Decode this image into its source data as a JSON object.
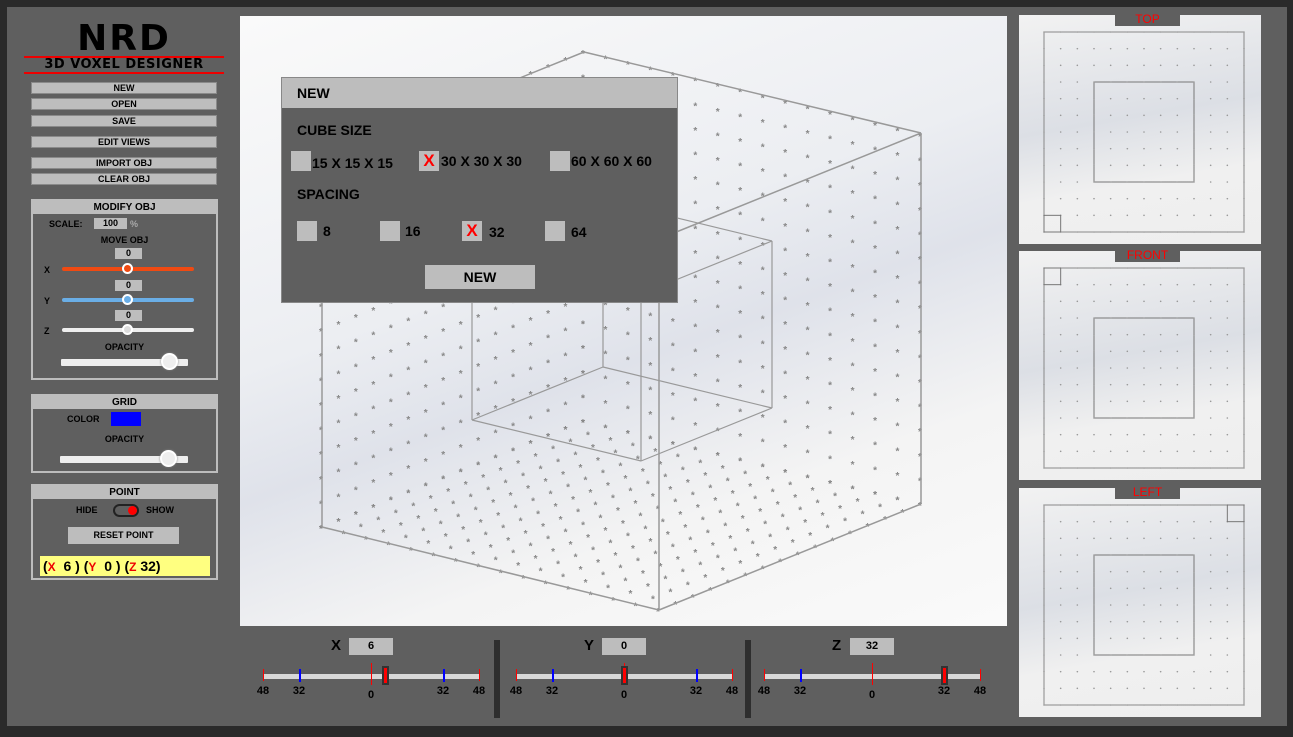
{
  "logo": {
    "title": "NRD",
    "subtitle": "3D VOXEL DESIGNER"
  },
  "menu": {
    "new": "NEW",
    "open": "OPEN",
    "save": "SAVE",
    "edit_views": "EDIT VIEWS",
    "import_obj": "IMPORT OBJ",
    "clear_obj": "CLEAR OBJ"
  },
  "modify": {
    "title": "MODIFY OBJ",
    "scale_label": "SCALE:",
    "scale_value": "100",
    "scale_unit": "%",
    "move_label": "MOVE OBJ",
    "x_label": "X",
    "y_label": "Y",
    "z_label": "Z",
    "x_value": "0",
    "y_value": "0",
    "z_value": "0",
    "opacity_label": "OPACITY",
    "opacity": 0.85
  },
  "grid": {
    "title": "GRID",
    "color_label": "COLOR",
    "color": "#0000ff",
    "opacity_label": "OPACITY",
    "opacity": 0.85
  },
  "point": {
    "title": "POINT",
    "hide_label": "HIDE",
    "show_label": "SHOW",
    "reset_label": "RESET POINT",
    "open": "(",
    "close": ")",
    "x_key": "X",
    "y_key": "Y",
    "z_key": "Z",
    "x": "6",
    "y": "0",
    "z": "32"
  },
  "dialog": {
    "title": "NEW",
    "cube_size_label": "CUBE SIZE",
    "sizes": [
      {
        "label": "15 X 15 X 15",
        "checked": false
      },
      {
        "label": "30 X 30 X 30",
        "checked": true
      },
      {
        "label": "60 X 60 X 60",
        "checked": false
      }
    ],
    "spacing_label": "SPACING",
    "spacings": [
      {
        "label": "8",
        "checked": false
      },
      {
        "label": "16",
        "checked": false
      },
      {
        "label": "32",
        "checked": true
      },
      {
        "label": "64",
        "checked": false
      }
    ],
    "check_mark": "X",
    "submit": "NEW"
  },
  "views": {
    "top": "TOP",
    "front": "FRONT",
    "left": "LEFT"
  },
  "axes": [
    {
      "label": "X",
      "value": 6,
      "ticks": {
        "end": "48",
        "mid": "32",
        "zero": "0"
      }
    },
    {
      "label": "Y",
      "value": 0,
      "ticks": {
        "end": "48",
        "mid": "32",
        "zero": "0"
      }
    },
    {
      "label": "Z",
      "value": 32,
      "ticks": {
        "end": "48",
        "mid": "32",
        "zero": "0"
      }
    }
  ],
  "colors": {
    "accent": "#ff0000",
    "x_slider": "#f04a12",
    "y_slider": "#6aaee6",
    "point_bg": "#ffff80"
  }
}
